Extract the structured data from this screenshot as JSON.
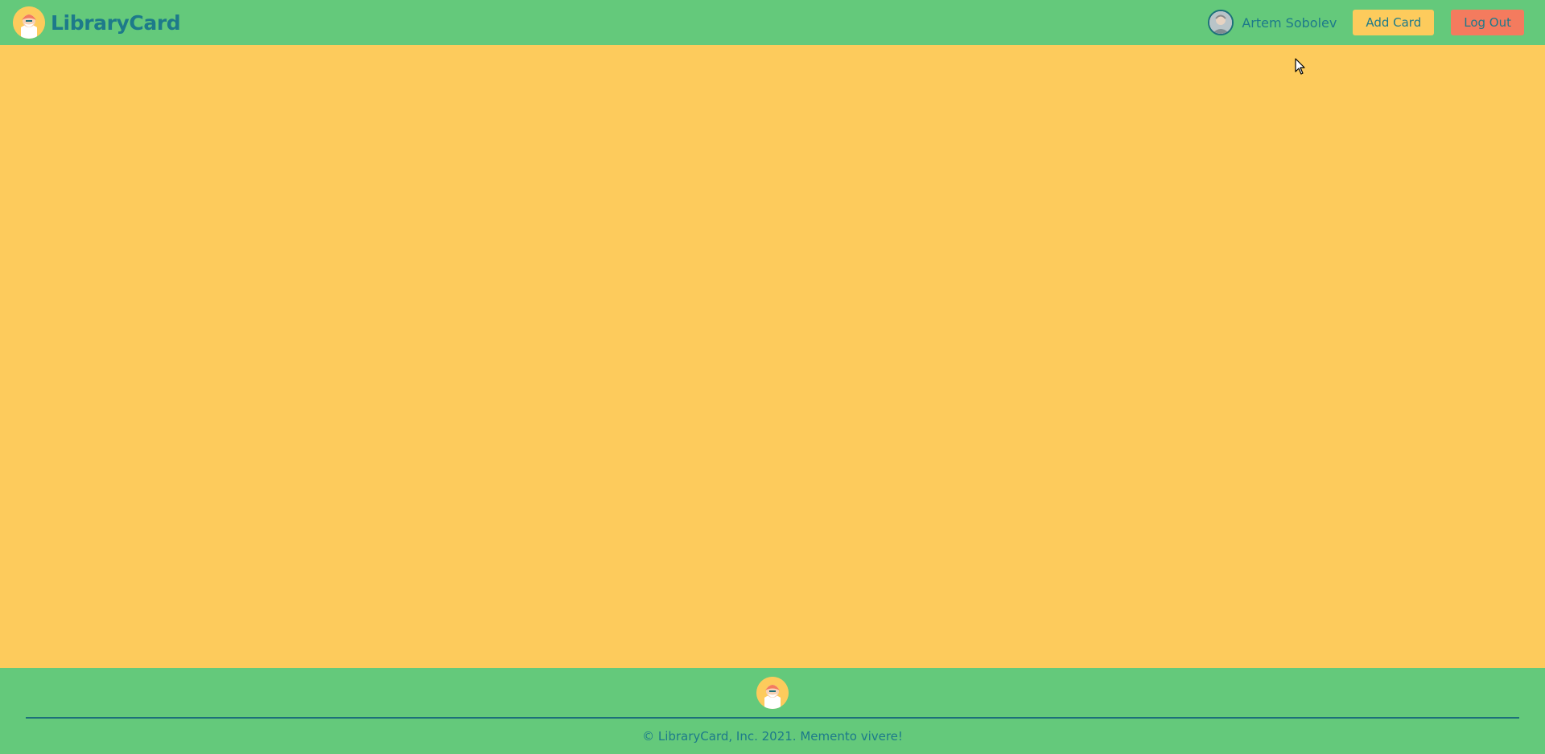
{
  "header": {
    "brand": "LibraryCard",
    "user_name": "Artem Sobolev",
    "add_card_label": "Add Card",
    "logout_label": "Log Out"
  },
  "footer": {
    "copyright": "© LibraryCard, Inc. 2021. Memento vivere!"
  },
  "colors": {
    "header_bg": "#64c97b",
    "page_bg": "#fdcb5c",
    "text_primary": "#1d7a8a",
    "logout_bg": "#f47b5e"
  }
}
